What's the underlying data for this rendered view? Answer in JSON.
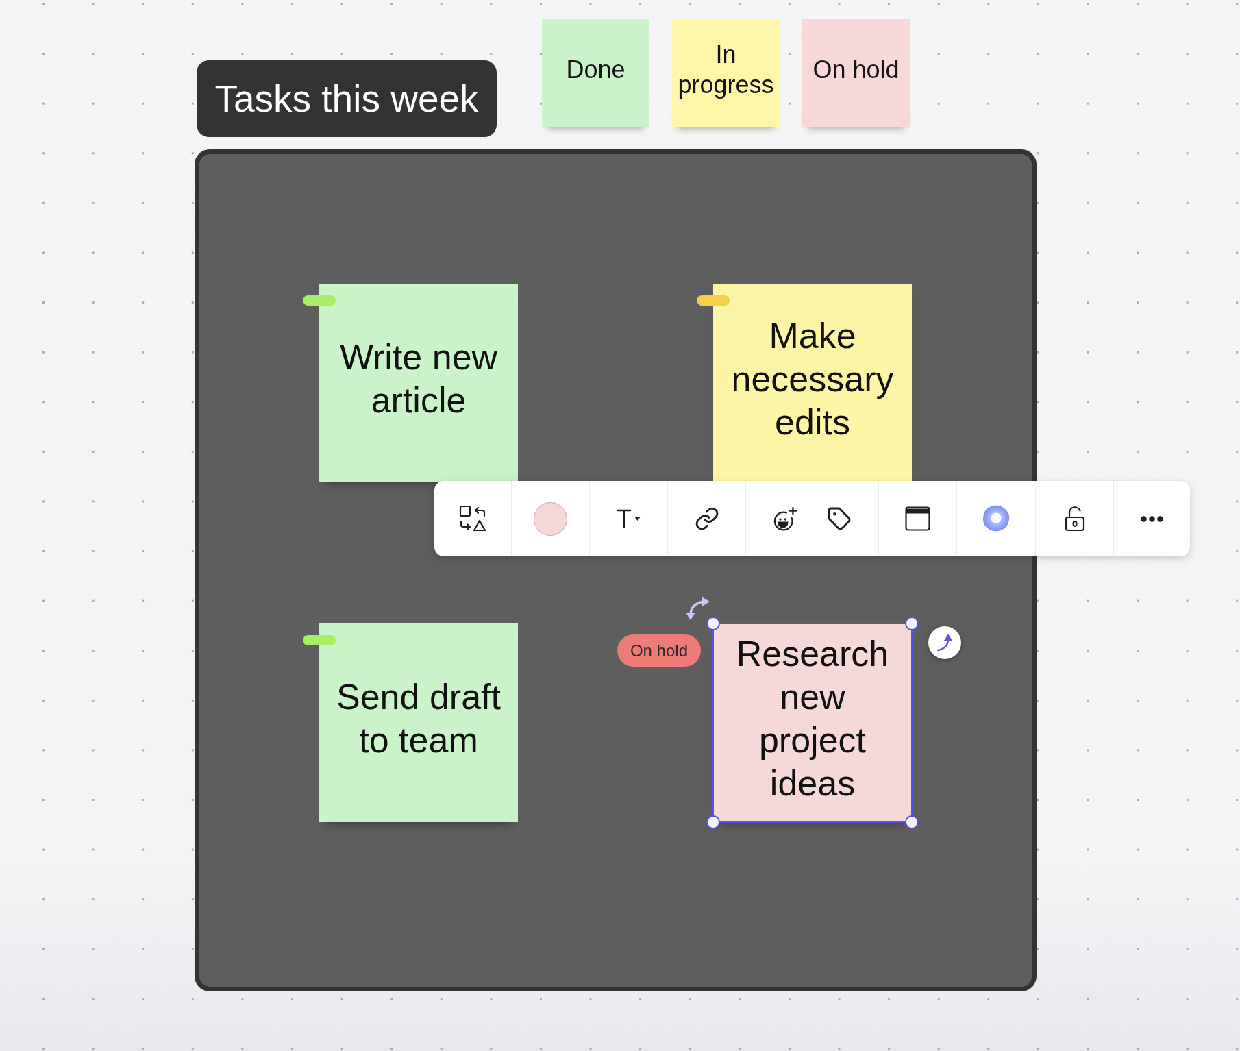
{
  "title": "Tasks this week",
  "legend": [
    {
      "label": "Done",
      "color": "#caf3ca"
    },
    {
      "label": "In progress",
      "color": "#fdf6a8"
    },
    {
      "label": "On hold",
      "color": "#f7d7d7"
    }
  ],
  "frame": {
    "notes": [
      {
        "text": "Write new article",
        "color": "#caf3ca",
        "selected": false,
        "tag": {
          "color": "#a6ee63"
        }
      },
      {
        "text": "Make necessary edits",
        "color": "#fdf5a6",
        "selected": false,
        "tag": {
          "color": "#f5cf4a"
        }
      },
      {
        "text": "Send draft to team",
        "color": "#caf3ca",
        "selected": false,
        "tag": {
          "color": "#a6ee63"
        }
      },
      {
        "text": "Research new project ideas",
        "color": "#f7d8d8",
        "selected": true,
        "tag": {
          "label": "On hold",
          "color": "#ee7b76"
        }
      }
    ]
  }
}
